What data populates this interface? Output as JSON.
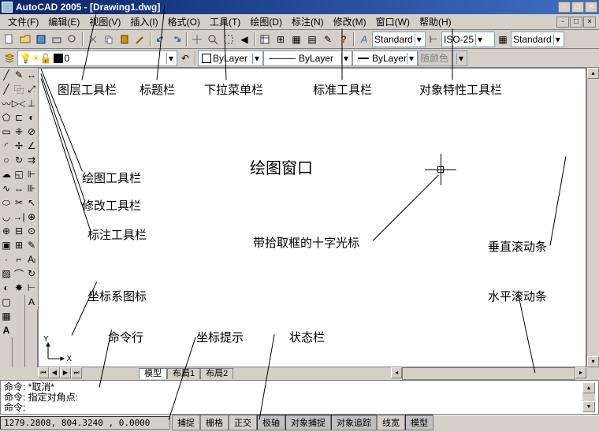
{
  "title": "AutoCAD 2005 - [Drawing1.dwg]",
  "menu": [
    "文件(F)",
    "编辑(E)",
    "视图(V)",
    "插入(I)",
    "格式(O)",
    "工具(T)",
    "绘图(D)",
    "标注(N)",
    "修改(M)",
    "窗口(W)",
    "帮助(H)"
  ],
  "styles": {
    "text": "Standard",
    "dim": "ISO-25",
    "table": "Standard"
  },
  "layer": {
    "current": "0"
  },
  "props": {
    "color": "ByLayer",
    "linetype": "ByLayer",
    "lineweight": "ByLayer",
    "plotstyle": "随颜色"
  },
  "tabs": [
    "模型",
    "布局1",
    "布局2"
  ],
  "cmd": {
    "line1": "命令:  *取消*",
    "line2": "命令: 指定对角点:",
    "prompt": "命令: "
  },
  "coords": "1279.2808, 804.3240 , 0.0000",
  "status_btns": [
    "捕捉",
    "栅格",
    "正交",
    "极轴",
    "对象捕捉",
    "对象追踪",
    "线宽",
    "模型"
  ],
  "labels": {
    "layer_tb": "图层工具栏",
    "title_bar": "标题栏",
    "menu_bar": "下拉菜单栏",
    "std_tb": "标准工具栏",
    "prop_tb": "对象特性工具栏",
    "draw_tb": "绘图工具栏",
    "modify_tb": "修改工具栏",
    "dim_tb": "标注工具栏",
    "drawing_win": "绘图窗口",
    "cursor": "带拾取框的十字光标",
    "vscroll": "垂直滚动条",
    "hscroll": "水平滚动条",
    "ucs": "坐标系图标",
    "cmdline": "命令行",
    "coord_tip": "坐标提示",
    "status": "状态栏"
  },
  "ucs_labels": {
    "x": "X",
    "y": "Y"
  }
}
